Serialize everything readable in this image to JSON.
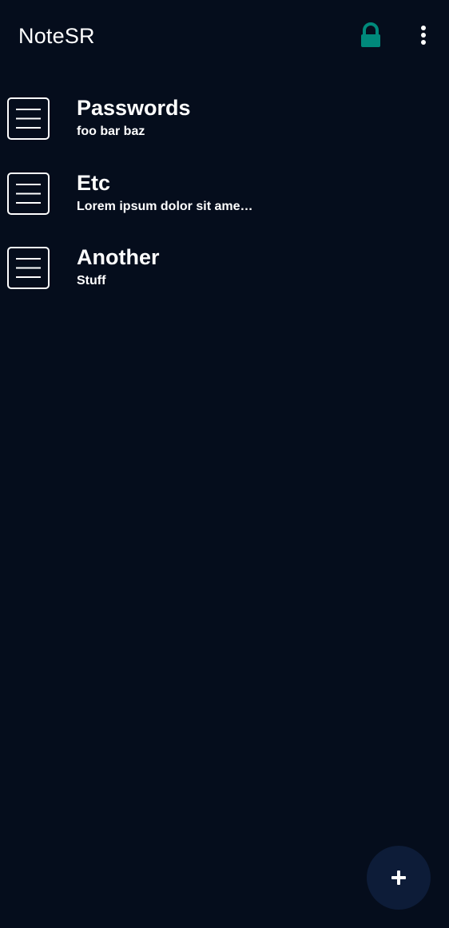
{
  "app_bar": {
    "title": "NoteSR",
    "lock_icon": "lock-icon",
    "menu_icon": "more-vertical-icon",
    "lock_color": "#00897b"
  },
  "notes": [
    {
      "title": "Passwords",
      "subtitle": "foo bar baz",
      "icon": "note-icon"
    },
    {
      "title": "Etc",
      "subtitle": "Lorem ipsum dolor sit ame…",
      "icon": "note-icon"
    },
    {
      "title": "Another",
      "subtitle": "Stuff",
      "icon": "note-icon"
    }
  ],
  "fab": {
    "icon": "plus-icon",
    "color": "#0d1c38"
  },
  "colors": {
    "background": "#050d1c",
    "text": "#ffffff"
  }
}
